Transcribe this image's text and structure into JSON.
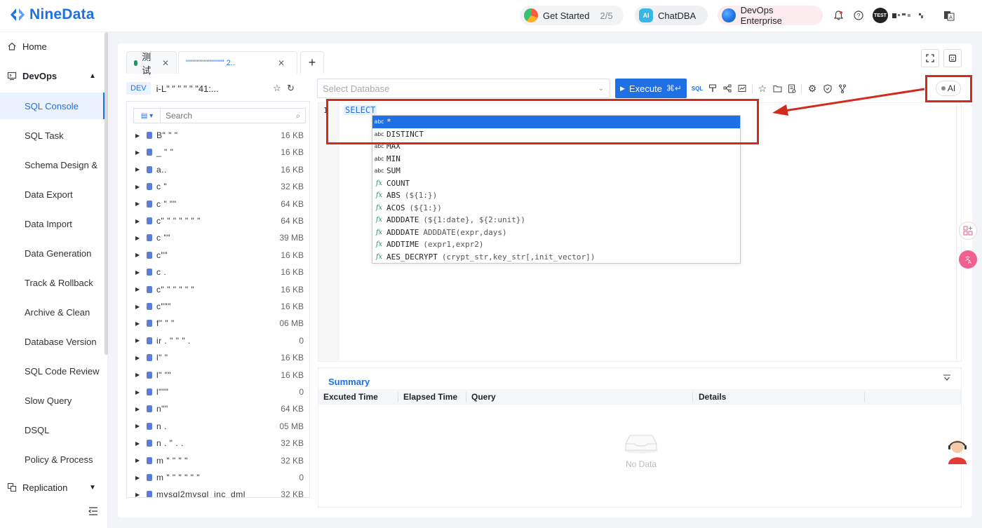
{
  "header": {
    "logo_text": "NineData",
    "get_started_label": "Get Started",
    "get_started_progress": "2/5",
    "chatdba_label": "ChatDBA",
    "chatdba_badge": "AI",
    "devops_label": "DevOps Enterprise",
    "avatar_label": "TEST"
  },
  "sidebar": {
    "home_label": "Home",
    "devops_label": "DevOps",
    "replication_label": "Replication",
    "items": [
      {
        "label": "SQL Console",
        "active": true
      },
      {
        "label": "SQL Task"
      },
      {
        "label": "Schema Design &"
      },
      {
        "label": "Data Export"
      },
      {
        "label": "Data Import"
      },
      {
        "label": "Data Generation"
      },
      {
        "label": "Track & Rollback"
      },
      {
        "label": "Archive & Clean"
      },
      {
        "label": "Database Version"
      },
      {
        "label": "SQL Code Review"
      },
      {
        "label": "Slow Query"
      },
      {
        "label": "DSQL"
      },
      {
        "label": "Policy & Process"
      }
    ]
  },
  "tabs": [
    {
      "label": "测试",
      "active": false
    },
    {
      "label": "\"\"\"\"\"\"\"\"\"\"\"\"\"\" 2..",
      "active": true
    }
  ],
  "connection": {
    "env_tag": "DEV",
    "name": "i-L\" \" \" \" \" \"41:..."
  },
  "tree": {
    "search_placeholder": "Search",
    "items": [
      {
        "name": "B\" \" \"",
        "size": "16 KB"
      },
      {
        "name": "_ \" \"",
        "size": "16 KB"
      },
      {
        "name": "a..",
        "size": "16 KB"
      },
      {
        "name": "c  \"",
        "size": "32 KB"
      },
      {
        "name": "c \" \"\"",
        "size": "64 KB"
      },
      {
        "name": "c\" \" \" \" \" \" \"",
        "size": "64 KB"
      },
      {
        "name": "c \"\"",
        "size": "39 MB"
      },
      {
        "name": "c\"\"",
        "size": "16 KB"
      },
      {
        "name": "c  .",
        "size": "16 KB"
      },
      {
        "name": "c\" \" \" \" \" \"",
        "size": "16 KB"
      },
      {
        "name": "c\"\"\"",
        "size": "16 KB"
      },
      {
        "name": "f\" \" \"",
        "size": "06 MB"
      },
      {
        "name": "ir . \" \" \" .",
        "size": "0"
      },
      {
        "name": "l\" \"",
        "size": "16 KB"
      },
      {
        "name": "l\" \"\"",
        "size": "16 KB"
      },
      {
        "name": "l\"\"\"",
        "size": "0"
      },
      {
        "name": "n\"\"",
        "size": "64 KB"
      },
      {
        "name": "n .",
        "size": "05 MB"
      },
      {
        "name": "n . \" . .",
        "size": "32 KB"
      },
      {
        "name": "m \" \" \" \"",
        "size": "32 KB"
      },
      {
        "name": "m \" \" \" \" \" \"",
        "size": "0"
      },
      {
        "name": "mysql2mysql_inc_dml",
        "size": "32 KB"
      }
    ]
  },
  "toolbar": {
    "db_placeholder": "Select Database",
    "execute_label": "Execute",
    "execute_shortcut": "⌘↵",
    "ai_label": "AI"
  },
  "editor": {
    "line_number": "1",
    "code": "SELECT"
  },
  "suggestions": [
    {
      "kind": "abc",
      "label": "*",
      "detail": "",
      "selected": true
    },
    {
      "kind": "abc",
      "label": "DISTINCT",
      "detail": ""
    },
    {
      "kind": "abc",
      "label": "MAX",
      "detail": ""
    },
    {
      "kind": "abc",
      "label": "MIN",
      "detail": ""
    },
    {
      "kind": "abc",
      "label": "SUM",
      "detail": ""
    },
    {
      "kind": "fx",
      "label": "COUNT",
      "detail": ""
    },
    {
      "kind": "fx",
      "label": "ABS",
      "detail": "(${1:})"
    },
    {
      "kind": "fx",
      "label": "ACOS",
      "detail": "(${1:})"
    },
    {
      "kind": "fx",
      "label": "ADDDATE",
      "detail": "(${1:date}, ${2:unit})"
    },
    {
      "kind": "fx",
      "label": "ADDDATE",
      "detail": "ADDDATE(expr,days)"
    },
    {
      "kind": "fx",
      "label": "ADDTIME",
      "detail": "(expr1,expr2)"
    },
    {
      "kind": "fx",
      "label": "AES_DECRYPT",
      "detail": "(crypt_str,key_str[,init_vector])"
    }
  ],
  "results": {
    "tab_label": "Summary",
    "columns": [
      "Excuted Time",
      "Elapsed Time",
      "Query",
      "Details"
    ],
    "empty_text": "No Data"
  },
  "colors": {
    "accent": "#1f6fe5",
    "annotation": "#d42a1e"
  }
}
